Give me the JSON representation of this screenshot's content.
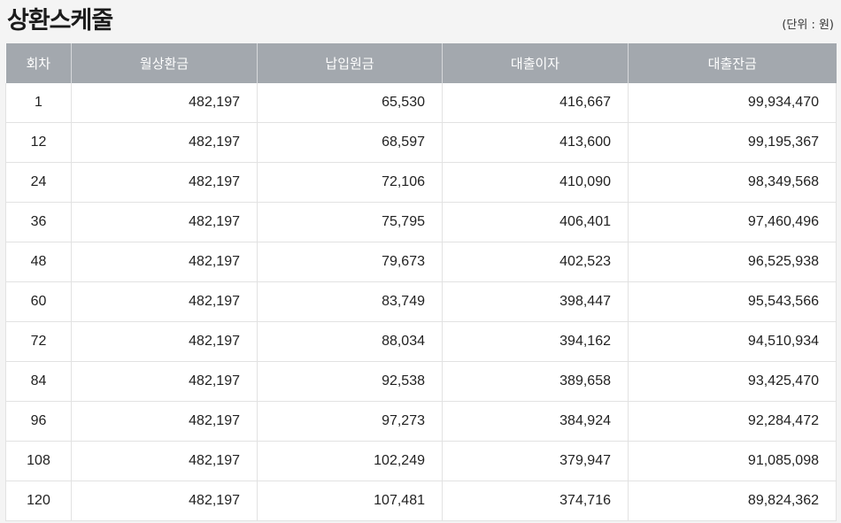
{
  "title": "상환스케줄",
  "unit": "(단위 : 원)",
  "columns": [
    "회차",
    "월상환금",
    "납입원금",
    "대출이자",
    "대출잔금"
  ],
  "rows": [
    [
      "1",
      "482,197",
      "65,530",
      "416,667",
      "99,934,470"
    ],
    [
      "12",
      "482,197",
      "68,597",
      "413,600",
      "99,195,367"
    ],
    [
      "24",
      "482,197",
      "72,106",
      "410,090",
      "98,349,568"
    ],
    [
      "36",
      "482,197",
      "75,795",
      "406,401",
      "97,460,496"
    ],
    [
      "48",
      "482,197",
      "79,673",
      "402,523",
      "96,525,938"
    ],
    [
      "60",
      "482,197",
      "83,749",
      "398,447",
      "95,543,566"
    ],
    [
      "72",
      "482,197",
      "88,034",
      "394,162",
      "94,510,934"
    ],
    [
      "84",
      "482,197",
      "92,538",
      "389,658",
      "93,425,470"
    ],
    [
      "96",
      "482,197",
      "97,273",
      "384,924",
      "92,284,472"
    ],
    [
      "108",
      "482,197",
      "102,249",
      "379,947",
      "91,085,098"
    ],
    [
      "120",
      "482,197",
      "107,481",
      "374,716",
      "89,824,362"
    ]
  ]
}
